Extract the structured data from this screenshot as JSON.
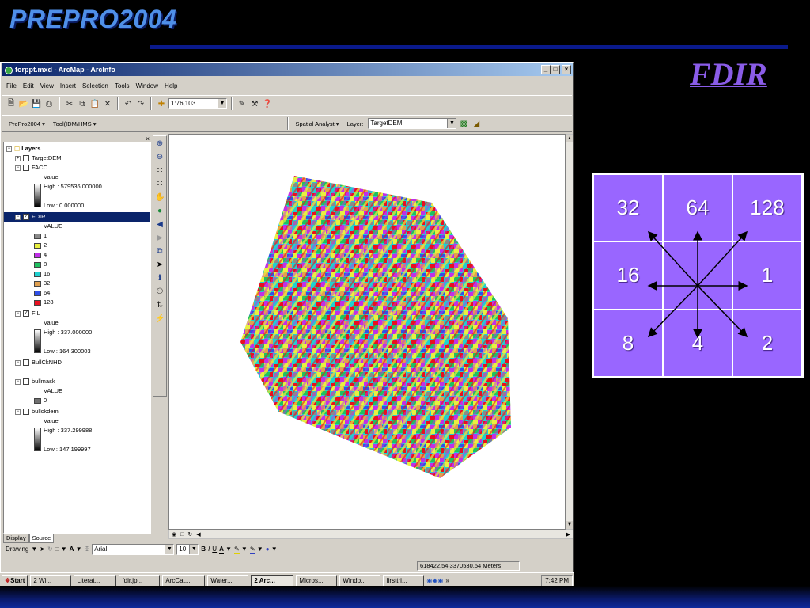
{
  "slide": {
    "title": "PREPRO2004",
    "side_title": "FDIR"
  },
  "window": {
    "title": "forppt.mxd - ArcMap - ArcInfo",
    "buttons": [
      "_",
      "×"
    ],
    "menu": [
      "File",
      "Edit",
      "View",
      "Insert",
      "Selection",
      "Tools",
      "Window",
      "Help"
    ]
  },
  "toolbar": {
    "scale": "1:76,103"
  },
  "toolbar2": {
    "prepro_menu": "PrePro2004 ▾",
    "tool_menu": "Tool(IDM/HMS ▾",
    "spatial_analyst": "Spatial Analyst ▾",
    "layer_label": "Layer:",
    "layer_value": "TargetDEM"
  },
  "toc": {
    "root": "Layers",
    "layers": [
      {
        "name": "TargetDEM"
      },
      {
        "name": "FACC",
        "field": "Value",
        "high": "High : 579536.000000",
        "low": "Low : 0.000000"
      },
      {
        "name": "FDIR",
        "field": "VALUE",
        "classes": [
          "1",
          "2",
          "4",
          "8",
          "16",
          "32",
          "64",
          "128"
        ]
      },
      {
        "name": "FIL",
        "field": "Value",
        "high": "High : 337.000000",
        "low": "Low : 164.300003"
      },
      {
        "name": "BullCkNHD"
      },
      {
        "name": "bullmask",
        "field": "VALUE",
        "classes": [
          "0"
        ]
      },
      {
        "name": "bullckdem",
        "field": "Value",
        "high": "High : 337.299988",
        "low": "Low : 147.199997"
      }
    ],
    "tabs": [
      "Display",
      "Source"
    ],
    "fdir_colors": [
      "#8a8a8a",
      "#e8f040",
      "#c030e8",
      "#20c060",
      "#20d0d0",
      "#e0a050",
      "#3050e8",
      "#e81020"
    ],
    "bullmask_color": "#707070"
  },
  "drawing": {
    "label": "Drawing",
    "font": "Arial",
    "size": "10",
    "bold": "B",
    "italic": "I",
    "underline": "U"
  },
  "status": {
    "coords": "618422.54  3370530.54 Meters"
  },
  "taskbar": {
    "start": "Start",
    "tasks": [
      "2 Wi...",
      "Literat...",
      "fdir.jp...",
      "ArcCat...",
      "Water...",
      "2 Arc...",
      "Micros...",
      "Windo...",
      "firsttri..."
    ],
    "active_index": 5,
    "clock": "7:42 PM"
  },
  "fdir_grid": {
    "cells": [
      "32",
      "64",
      "128",
      "16",
      "",
      "1",
      "8",
      "4",
      "2"
    ],
    "color": "#9966ff"
  }
}
